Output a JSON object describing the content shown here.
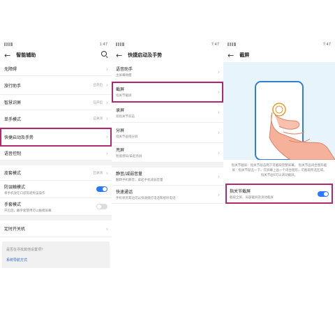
{
  "panel1": {
    "status_time": "1:47",
    "title": "智能辅助",
    "rows": [
      {
        "label": "无障碍"
      },
      {
        "label": "旅行助手",
        "value": "已开启"
      },
      {
        "label": "智慧识屏",
        "value": "已开启"
      },
      {
        "label": "单手模式",
        "value": "已关闭"
      },
      {
        "label": "快捷启动及手势"
      },
      {
        "label": "语音控制"
      },
      {
        "label": "皮套模式",
        "value": "已关闭"
      },
      {
        "label": "防误触模式",
        "sub": "将手机放在口袋等避免误操作",
        "toggle": "on"
      },
      {
        "label": "手套模式",
        "sub": "开启后，戴手套使用可以触摸屏幕",
        "toggle": "off"
      },
      {
        "label": "定时开关机"
      }
    ],
    "card": {
      "question": "是否在寻找其他设置项？",
      "link": "系统导航方式"
    }
  },
  "panel2": {
    "status_time": "7:47",
    "title": "快捷启动及手势",
    "rows": [
      {
        "label": "语音助手",
        "sub": "主屏幕唤醒"
      },
      {
        "label": "截屏",
        "sub": "指关节截屏"
      },
      {
        "label": "录屏",
        "sub": "双指关节双击"
      },
      {
        "label": "分屏",
        "sub": "指关节画线分屏"
      },
      {
        "label": "亮屏",
        "sub": "智能感知/拿起亮屏"
      },
      {
        "label": "静音/减弱音量",
        "sub": "翻转手机静音，拿起手机减弱音量"
      },
      {
        "label": "快速通话",
        "sub": "手机举到耳边可以快速拨打电话和接听电话"
      }
    ]
  },
  "panel3": {
    "status_time": "7:47",
    "title": "截屏",
    "description": "指关节截屏：指关节敲击两下可截取完整屏幕。 指关节画闭合图形截屏：指关节敲击一下，在屏幕上画一个闭合图形，可截取所选区域。 指关节画S可以滚动截屏。",
    "knuckle": {
      "label": "指关节截屏",
      "sub": "截取全屏、局部截屏及滚动截屏",
      "toggle": "on"
    }
  }
}
